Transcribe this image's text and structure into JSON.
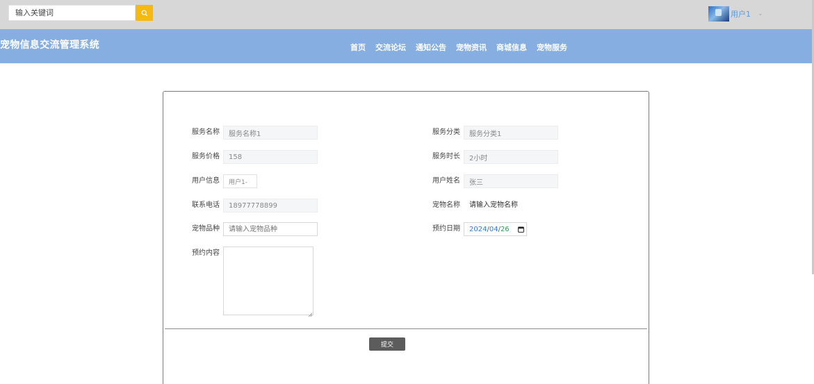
{
  "search": {
    "placeholder": "输入关键词",
    "icon": "search-icon"
  },
  "user": {
    "name": "用户1",
    "caret": "⌄"
  },
  "site": {
    "title": "宠物信息交流管理系统"
  },
  "nav": [
    "首页",
    "交流论坛",
    "通知公告",
    "宠物资讯",
    "商城信息",
    "宠物服务"
  ],
  "colors": {
    "nav_bg": "#86aee0",
    "topbar_bg": "#d7d7d7",
    "search_btn": "#f5b911",
    "submit_btn": "#5c5c5c"
  },
  "form": {
    "service_name": {
      "label": "服务名称",
      "value": "服务名称1"
    },
    "service_category": {
      "label": "服务分类",
      "value": "服务分类1"
    },
    "service_price": {
      "label": "服务价格",
      "value": "158"
    },
    "service_duration": {
      "label": "服务时长",
      "value": "2小时"
    },
    "user_info": {
      "label": "用户信息",
      "value": "用户1-"
    },
    "user_name": {
      "label": "用户姓名",
      "value": "张三"
    },
    "phone": {
      "label": "联系电话",
      "value": "18977778899"
    },
    "pet_name": {
      "label": "宠物名称",
      "value": "请输入宠物名称"
    },
    "pet_breed": {
      "label": "宠物品种",
      "placeholder": "请输入宠物品种"
    },
    "appointment_date": {
      "label": "预约日期",
      "year": "2024",
      "month": "04",
      "day": "26",
      "sep": "/"
    },
    "appointment_content": {
      "label": "预约内容",
      "value": ""
    }
  },
  "submit_label": "提交"
}
